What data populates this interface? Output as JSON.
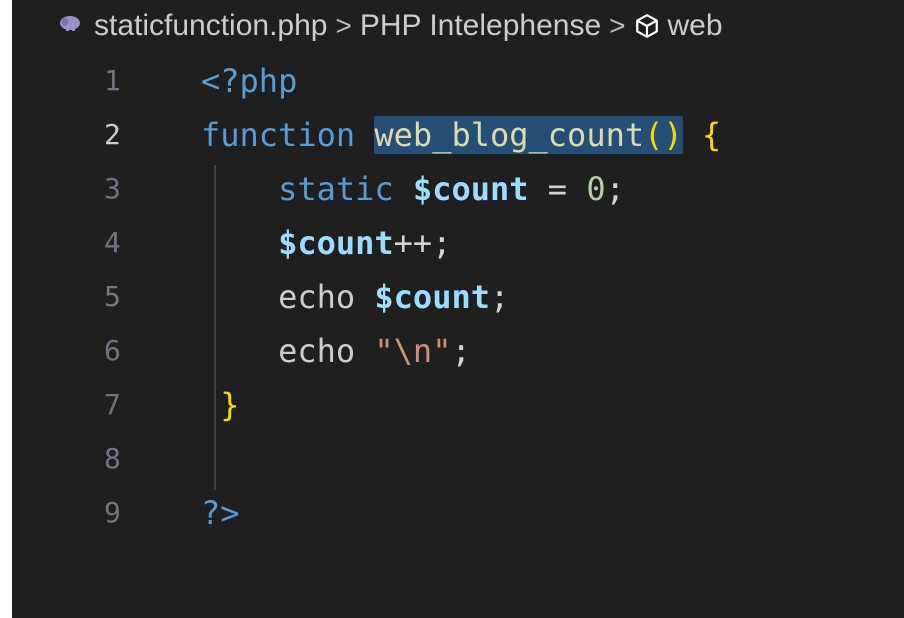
{
  "breadcrumb": {
    "file_icon": "php-elephant-icon",
    "file": "staticfunction.php",
    "separator": ">",
    "provider": "PHP Intelephense",
    "symbol_icon": "cube-icon",
    "symbol": "web"
  },
  "editor": {
    "active_line": 2,
    "lines": [
      {
        "number": "1",
        "tokens": [
          {
            "t": "<?php"
          }
        ]
      },
      {
        "number": "2",
        "tokens": [
          {
            "t": "function"
          },
          {
            "t": " "
          },
          {
            "t": "web_blog_count"
          },
          {
            "t": "()"
          },
          {
            "t": " "
          },
          {
            "t": "{"
          }
        ]
      },
      {
        "number": "3",
        "tokens": [
          {
            "t": "    "
          },
          {
            "t": "static"
          },
          {
            "t": " "
          },
          {
            "t": "$count"
          },
          {
            "t": " = "
          },
          {
            "t": "0"
          },
          {
            "t": ";"
          }
        ]
      },
      {
        "number": "4",
        "tokens": [
          {
            "t": "    "
          },
          {
            "t": "$count"
          },
          {
            "t": "++;"
          }
        ]
      },
      {
        "number": "5",
        "tokens": [
          {
            "t": "    "
          },
          {
            "t": "echo"
          },
          {
            "t": " "
          },
          {
            "t": "$count"
          },
          {
            "t": ";"
          }
        ]
      },
      {
        "number": "6",
        "tokens": [
          {
            "t": "    "
          },
          {
            "t": "echo"
          },
          {
            "t": " "
          },
          {
            "t": "\"\\n\""
          },
          {
            "t": ";"
          }
        ]
      },
      {
        "number": "7",
        "tokens": [
          {
            "t": " "
          },
          {
            "t": "}"
          }
        ]
      },
      {
        "number": "8",
        "tokens": []
      },
      {
        "number": "9",
        "tokens": [
          {
            "t": "?>"
          }
        ]
      }
    ]
  },
  "colors": {
    "editor_bg": "#1f1f1f",
    "keyword": "#569cd6",
    "variable": "#9cdcfe",
    "function": "#dcdcaa",
    "brace": "#ffd700",
    "number": "#b5cea8",
    "string": "#ce9178",
    "selection": "#264f78"
  }
}
